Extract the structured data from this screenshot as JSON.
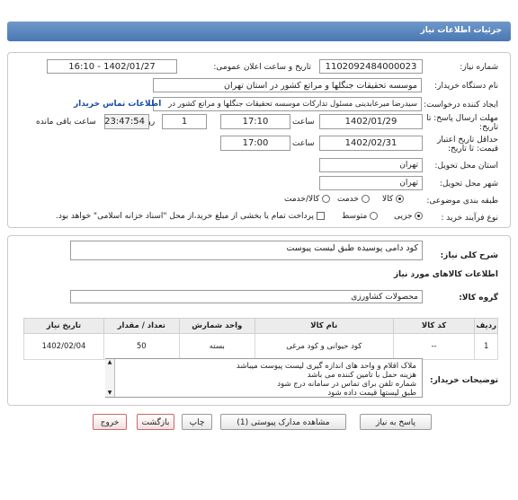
{
  "header": {
    "title": "جزئیات اطلاعات نیاز"
  },
  "need_number": {
    "label": "شماره نیاز:",
    "value": "1102092484000023"
  },
  "announce": {
    "label": "تاریخ و ساعت اعلان عمومی:",
    "value": "1402/01/27 - 16:10"
  },
  "buyer_org": {
    "label": "نام دستگاه خریدار:",
    "value": "موسسه تحقیقات جنگلها و مراتع کشور در استان تهران"
  },
  "requester": {
    "label": "ایجاد کننده درخواست:",
    "value": "سیدرضا میرعابدینی مسئول تدارکات موسسه تحقیقات جنگلها و مراتع کشور در",
    "contact_link": "اطلاعات تماس خریدار"
  },
  "deadline": {
    "label": "مهلت ارسال پاسخ: تا تاریخ:",
    "date": "1402/01/29",
    "time_label": "ساعت",
    "time": "17:10",
    "days": "1",
    "days_label": "روز و",
    "remaining": "23:47:54",
    "remaining_label": "ساعت باقی مانده"
  },
  "validity": {
    "label": "حداقل تاریخ اعتبار قیمت: تا تاریخ:",
    "date": "1402/02/31",
    "time_label": "ساعت",
    "time": "17:00"
  },
  "province": {
    "label": "استان محل تحویل:",
    "value": "تهران"
  },
  "city": {
    "label": "شهر محل تحویل:",
    "value": "تهران"
  },
  "category": {
    "label": "طبقه بندی موضوعی:",
    "options": [
      "کالا",
      "خدمت",
      "کالا/خدمت"
    ]
  },
  "process": {
    "label": "نوع فرآیند خرید :",
    "options": [
      "جزیی",
      "متوسط"
    ],
    "note": "پرداخت تمام یا بخشی از مبلغ خرید،از محل \"اسناد خزانه اسلامی\" خواهد بود."
  },
  "description": {
    "label": "شرح کلی نیاز:",
    "value": "کود دامی پوسیده طبق لیست پیوست"
  },
  "goods_info": {
    "label": "اطلاعات کالاهای مورد نیاز"
  },
  "group": {
    "label": "گروه کالا:",
    "value": "محصولات کشاورزی"
  },
  "table": {
    "headers": [
      "ردیف",
      "کد کالا",
      "نام کالا",
      "واحد شمارش",
      "تعداد / مقدار",
      "تاریخ نیاز"
    ],
    "rows": [
      [
        "1",
        "--",
        "کود حیوانی و کود مرغی",
        "بسته",
        "50",
        "1402/02/04"
      ]
    ]
  },
  "buyer_notes": {
    "label": "توضیحات خریدار:",
    "lines": [
      "ملاک اقلام و واحد های اندازه گیری لیست پیوست میباشد",
      "هزینه حمل با تامین کننده می باشد",
      "شماره تلفن برای تماس در سامانه درج شود",
      "طبق لیستها قیمت داده شود"
    ]
  },
  "buttons": {
    "reply": "پاسخ به نیاز",
    "attachments": "مشاهده مدارک پیوستی (1)",
    "print": "چاپ",
    "back": "بازگشت",
    "exit": "خروج"
  },
  "watermark": {
    "line1": "ParsNamadData",
    "line2": "پایگاه اطلاع رسانی مناقصات و مزایده های ایران",
    "phone": "۰۲۱-۸۸۳۴۹۶۷۰"
  }
}
